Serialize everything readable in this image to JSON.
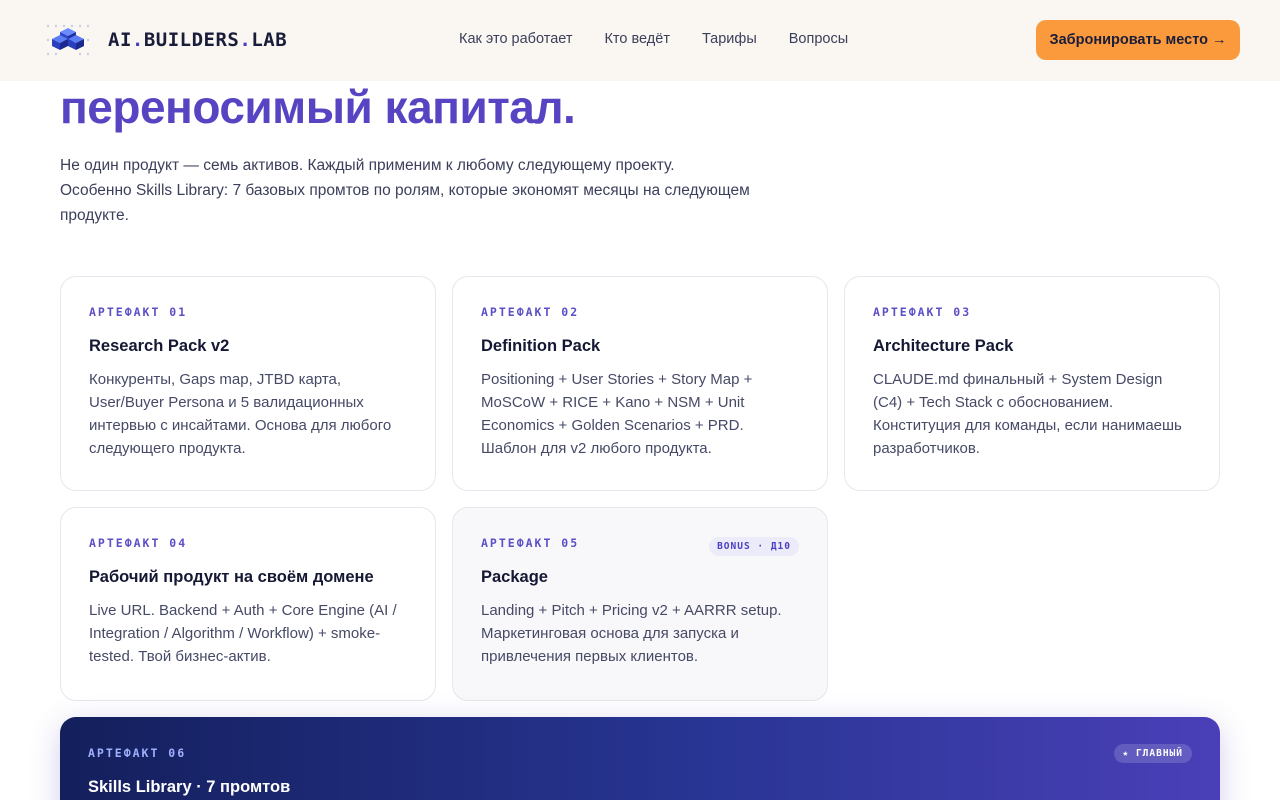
{
  "header": {
    "logo_prefix": "AI",
    "logo_middle": "BUILDERS",
    "logo_suffix": "LAB",
    "nav": [
      {
        "label": "Как это работает"
      },
      {
        "label": "Кто ведёт"
      },
      {
        "label": "Тарифы"
      },
      {
        "label": "Вопросы"
      }
    ],
    "cta_label": "Забронировать место →"
  },
  "hero": {
    "title_line2": "переносимый капитал.",
    "description": "Не один продукт — семь активов. Каждый применим к любому следующему проекту. Особенно Skills Library: 7 базовых промтов по ролям, которые экономят месяцы на следующем продукте."
  },
  "cards": [
    {
      "label": "АРТЕФАКТ 01",
      "title": "Research Pack v2",
      "description": "Конкуренты, Gaps map, JTBD карта, User/Buyer Persona и 5 валидационных интервью с инсайтами. Основа для любого следующего продукта."
    },
    {
      "label": "АРТЕФАКТ 02",
      "title": "Definition Pack",
      "description": "Positioning + User Stories + Story Map + MoSCoW + RICE + Kano + NSM + Unit Economics + Golden Scenarios + PRD. Шаблон для v2 любого продукта."
    },
    {
      "label": "АРТЕФАКТ 03",
      "title": "Architecture Pack",
      "description": "CLAUDE.md финальный + System Design (C4) + Tech Stack с обоснованием. Конституция для команды, если нанимаешь разработчиков."
    },
    {
      "label": "АРТЕФАКТ 04",
      "title": "Рабочий продукт на своём домене",
      "description": "Live URL. Backend + Auth + Core Engine (AI / Integration / Algorithm / Workflow) + smoke-tested. Твой бизнес-актив."
    },
    {
      "label": "АРТЕФАКТ 05",
      "title": "Package",
      "badge": "BONUS · Д10",
      "description": "Landing + Pitch + Pricing v2 + AARRR setup. Маркетинговая основа для запуска и привлечения первых клиентов."
    }
  ],
  "featured": {
    "label": "АРТЕФАКТ 06",
    "badge": "★ ГЛАВНЫЙ",
    "title": "Skills Library · 7 промтов"
  },
  "colors": {
    "accent": "#5744c2",
    "cta": "#fb9a3c",
    "header_bg": "#faf7f2"
  }
}
